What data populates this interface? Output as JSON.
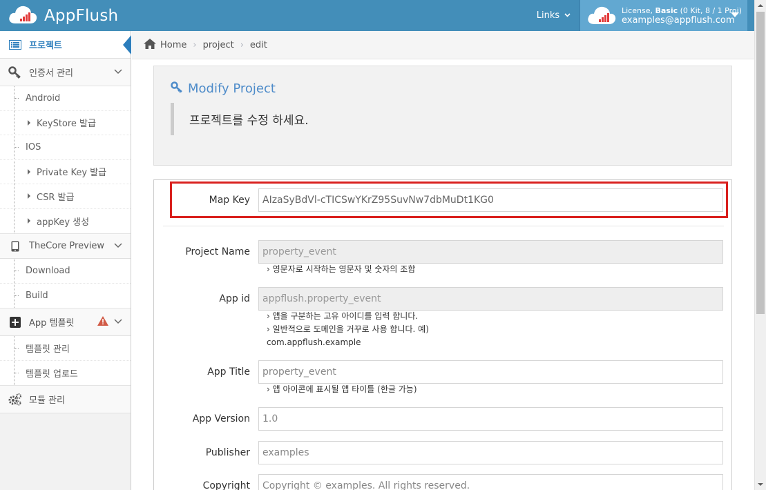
{
  "app": {
    "brand": "AppFlush",
    "links_label": "Links",
    "license_prefix": "License, ",
    "license_plan": "Basic",
    "license_detail": " (0 Kit, 8 / 1 Proj)",
    "user_email": "examples@appflush.com"
  },
  "sidebar": {
    "project": "프로젝트",
    "cert_mgmt": "인증서 관리",
    "android": "Android",
    "keystore": "KeyStore 발급",
    "ios": "IOS",
    "private_key": "Private Key 발급",
    "csr": "CSR 발급",
    "appkey": "appKey 생성",
    "thecore_preview": "TheCore Preview",
    "download": "Download",
    "build": "Build",
    "app_template": "App 템플릿",
    "template_mgmt": "템플릿 관리",
    "template_upload": "템플릿 업로드",
    "module_mgmt": "모듈 관리"
  },
  "breadcrumb": {
    "home": "Home",
    "project": "project",
    "edit": "edit"
  },
  "page": {
    "title": "Modify Project",
    "subtitle": "프로젝트를 수정 하세요."
  },
  "form": {
    "map_key_label": "Map Key",
    "map_key_value": "AIzaSyBdVl-cTICSwYKrZ95SuvNw7dbMuDt1KG0",
    "project_name_label": "Project Name",
    "project_name_value": "property_event",
    "project_name_hint": "› 영문자로 시작하는 영문자 및 숫자의 조합",
    "app_id_label": "App id",
    "app_id_value": "appflush.property_event",
    "app_id_hint1": "› 앱을 구분하는 고유 아이디를 입력 합니다.",
    "app_id_hint2": "› 일반적으로 도메인을 거꾸로 사용 합니다. 예)",
    "app_id_hint3": "com.appflush.example",
    "app_title_label": "App Title",
    "app_title_placeholder": "property_event",
    "app_title_hint": "› 앱 아이콘에 표시될 앱 타이틀 (한글 가능)",
    "app_version_label": "App Version",
    "app_version_placeholder": "1.0",
    "publisher_label": "Publisher",
    "publisher_placeholder": "examples",
    "copyright_label": "Copyright",
    "copyright_placeholder": "Copyright © examples. All rights reserved."
  },
  "colors": {
    "topbar": "#438eb9",
    "user_panel": "#62a8d1",
    "highlight": "#d9201e",
    "title": "#4d8bc9"
  }
}
